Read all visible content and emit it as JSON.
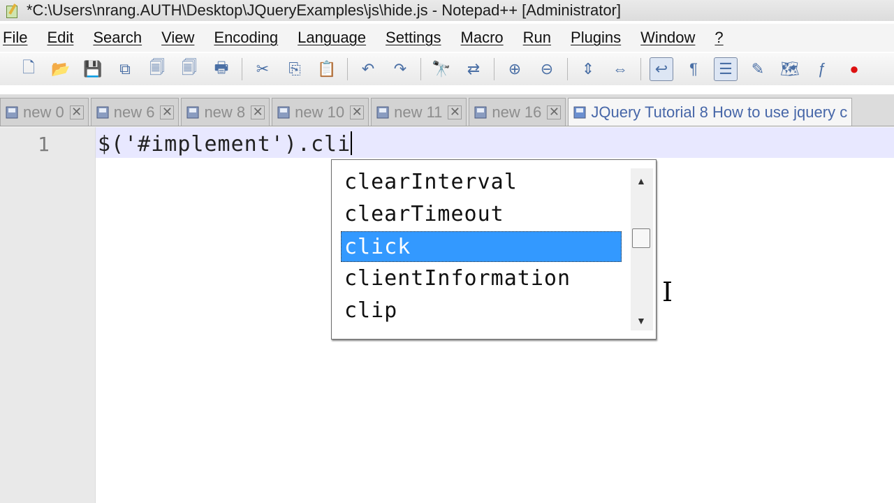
{
  "window": {
    "title": "*C:\\Users\\nrang.AUTH\\Desktop\\JQueryExamples\\js\\hide.js - Notepad++ [Administrator]",
    "app_icon": "notepad-plus-plus-icon"
  },
  "menu": {
    "items": [
      "File",
      "Edit",
      "Search",
      "View",
      "Encoding",
      "Language",
      "Settings",
      "Macro",
      "Run",
      "Plugins",
      "Window",
      "?"
    ]
  },
  "toolbar": {
    "buttons": [
      {
        "icon": "new-file-icon",
        "glyph": "🗋"
      },
      {
        "icon": "open-folder-icon",
        "glyph": "📂"
      },
      {
        "icon": "save-icon",
        "glyph": "💾"
      },
      {
        "icon": "save-all-icon",
        "glyph": "⧉"
      },
      {
        "icon": "close-icon",
        "glyph": "🗐"
      },
      {
        "icon": "close-all-icon",
        "glyph": "🗐"
      },
      {
        "icon": "print-icon",
        "glyph": "🖶"
      },
      {
        "icon": "cut-icon",
        "glyph": "✂"
      },
      {
        "icon": "copy-icon",
        "glyph": "⎘"
      },
      {
        "icon": "paste-icon",
        "glyph": "📋"
      },
      {
        "icon": "undo-icon",
        "glyph": "↶"
      },
      {
        "icon": "redo-icon",
        "glyph": "↷"
      },
      {
        "icon": "find-icon",
        "glyph": "🔭"
      },
      {
        "icon": "replace-icon",
        "glyph": "⇄"
      },
      {
        "icon": "zoom-in-icon",
        "glyph": "⊕"
      },
      {
        "icon": "zoom-out-icon",
        "glyph": "⊖"
      },
      {
        "icon": "sync-vertical-icon",
        "glyph": "⇕"
      },
      {
        "icon": "sync-horizontal-icon",
        "glyph": "⇔"
      },
      {
        "icon": "word-wrap-icon",
        "glyph": "↩"
      },
      {
        "icon": "show-all-characters-icon",
        "glyph": "¶"
      },
      {
        "icon": "indent-guide-icon",
        "glyph": "☰"
      },
      {
        "icon": "user-language-icon",
        "glyph": "✎"
      },
      {
        "icon": "document-map-icon",
        "glyph": "🗺"
      },
      {
        "icon": "function-list-icon",
        "glyph": "ƒ"
      },
      {
        "icon": "record-macro-icon",
        "glyph": "●"
      }
    ]
  },
  "tabs": [
    {
      "label": "new  0",
      "active": false
    },
    {
      "label": "new  6",
      "active": false
    },
    {
      "label": "new  8",
      "active": false
    },
    {
      "label": "new  10",
      "active": false
    },
    {
      "label": "new  11",
      "active": false
    },
    {
      "label": "new  16",
      "active": false
    },
    {
      "label": "JQuery Tutorial 8 How to use jquery c",
      "active": true
    }
  ],
  "editor": {
    "line_number": "1",
    "code": "$('#implement').cli"
  },
  "autocomplete": {
    "items": [
      "clearInterval",
      "clearTimeout",
      "click",
      "clientInformation",
      "clip"
    ],
    "selected_index": 2
  },
  "colors": {
    "selection": "#3399ff",
    "current_line": "#e8e8ff",
    "gutter": "#e9e9e9"
  }
}
